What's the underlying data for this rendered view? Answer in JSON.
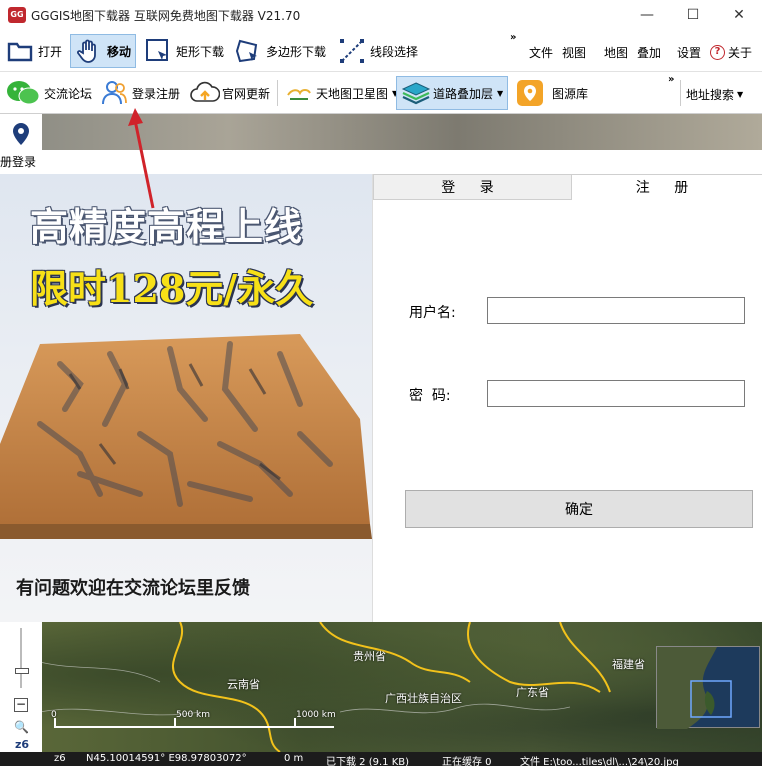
{
  "window": {
    "title": "GGGIS地图下载器  互联网免费地图下载器 V21.70",
    "logo_text": "GG"
  },
  "toolbar1": {
    "items": [
      "打开",
      "移动",
      "矩形下载",
      "多边形下载",
      "线段选择"
    ],
    "overflow": "»",
    "menu": [
      "文件",
      "视图",
      "地图",
      "叠加",
      "设置",
      "关于"
    ]
  },
  "toolbar2": {
    "items": [
      "交流论坛",
      "登录注册",
      "官网更新",
      "天地图卫星图",
      "道路叠加层",
      "图源库"
    ],
    "overflow": "»",
    "address_search": "地址搜索"
  },
  "dialog": {
    "title": "册登录",
    "promo_line1": "高精度高程上线",
    "promo_line2": "限时128元/永久",
    "feedback": "有问题欢迎在交流论坛里反馈",
    "tabs": [
      "登 录",
      "注 册"
    ],
    "username_label": "用户名:",
    "password_label": "密  码:",
    "username_value": "",
    "password_value": "",
    "confirm_label": "确定"
  },
  "map": {
    "provinces": [
      "贵州省",
      "云南省",
      "广西壮族自治区",
      "广东省",
      "福建省"
    ],
    "scale": [
      "0",
      "500 km",
      "1000 km"
    ],
    "zoom_level": "z6"
  },
  "statusbar": {
    "zoom": "z6",
    "coords": "N45.10014591° E98.97803072°",
    "scale": "0 m",
    "downloaded": "已下载 2 (9.1 KB)",
    "caching": "正在缓存 0",
    "file": "文件 E:\\too...tiles\\dl\\...\\24\\20.jpg"
  },
  "colors": {
    "accent": "#2a6fc4",
    "promo_yellow": "#f7e017",
    "arrow": "#d0232a"
  }
}
